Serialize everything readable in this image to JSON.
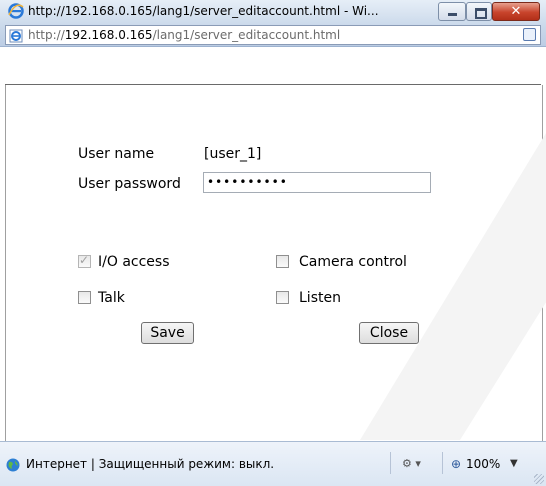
{
  "window": {
    "title": "http://192.168.0.165/lang1/server_editaccount.html - Wi...",
    "address_prefix": "http://",
    "address_host": "192.168.0.165",
    "address_path": "/lang1/server_editaccount.html"
  },
  "form": {
    "user_name_label": "User name",
    "user_name_value": "[user_1]",
    "password_label": "User password",
    "password_value": "••••••••••",
    "permissions": [
      {
        "label": "I/O access",
        "checked": true,
        "disabled": true
      },
      {
        "label": "Camera control",
        "checked": false
      },
      {
        "label": "Talk",
        "checked": false
      },
      {
        "label": "Listen",
        "checked": false
      }
    ],
    "save_label": "Save",
    "close_label": "Close"
  },
  "status": {
    "zone_text": "Интернет | Защищенный режим: выкл.",
    "zoom": "100%"
  },
  "icons": {
    "browser": "ie-icon",
    "page": "page-icon",
    "compat": "compatibility-view-icon",
    "globe": "internet-globe-icon",
    "zoom": "zoom-icon"
  }
}
